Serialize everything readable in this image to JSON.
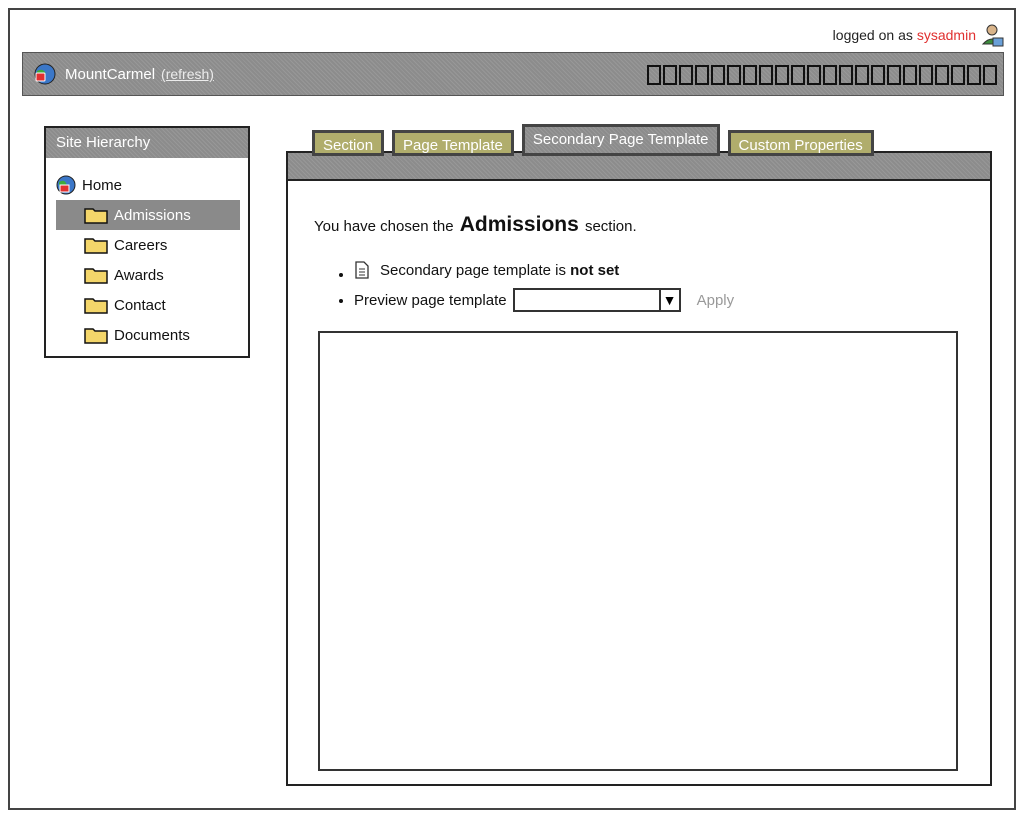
{
  "header": {
    "logged_on_prefix": "logged on as",
    "username": "sysadmin",
    "site_name": "MountCarmel",
    "refresh_label": "(refresh)"
  },
  "hierarchy": {
    "title": "Site Hierarchy",
    "root": "Home",
    "items": [
      "Admissions",
      "Careers",
      "Awards",
      "Contact",
      "Documents"
    ],
    "selected": "Admissions"
  },
  "tabs": [
    "Section",
    "Page Template",
    "Secondary Page Template",
    "Custom Properties"
  ],
  "active_tab": "Secondary Page Template",
  "content": {
    "chosen_prefix": "You have chosen the",
    "section_name": "Admissions",
    "chosen_suffix": "section.",
    "secondary_label": "Secondary page template is",
    "secondary_status": "not set",
    "preview_label": "Preview page template",
    "preview_value": "",
    "apply_label": "Apply"
  },
  "colors": {
    "bar_gray": "#8c8c8c",
    "tab_olive": "#b0ad6c",
    "username_red": "#e03030",
    "apply_gray": "#999999"
  }
}
